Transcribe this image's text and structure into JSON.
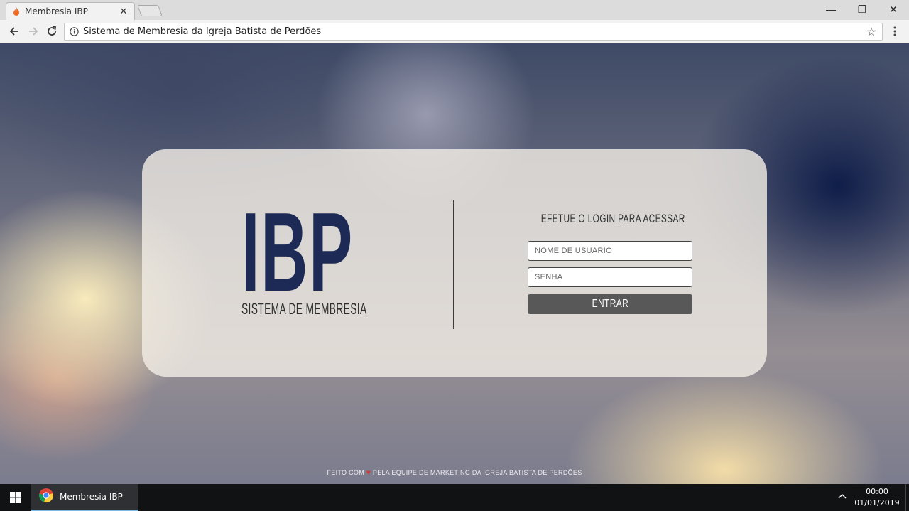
{
  "browser": {
    "tab_title": "Membresia IBP",
    "tab_close": "✕",
    "address": "Sistema de Membresia da Igreja Batista de Perdões",
    "window_controls": {
      "minimize": "—",
      "maximize": "❐",
      "close": "✕"
    }
  },
  "login": {
    "brand_mark": "IBP",
    "brand_subtitle": "SISTEMA DE MEMBRESIA",
    "title": "EFETUE O LOGIN PARA ACESSAR",
    "username_placeholder": "NOME DE USUÁRIO",
    "password_placeholder": "SENHA",
    "submit_label": "ENTRAR"
  },
  "footer": {
    "prefix": "FEITO COM",
    "heart": "♥",
    "suffix": "PELA EQUIPE DE MARKETING DA IGREJA BATISTA DE PERDÕES"
  },
  "taskbar": {
    "app_label": "Membresia IBP",
    "tray_chevron": "^",
    "time": "00:00",
    "date": "01/01/2019"
  },
  "colors": {
    "brand_navy": "#1c2a55",
    "button_gray": "#585858",
    "heart_red": "#d23a3a",
    "taskbar": "#101214"
  }
}
